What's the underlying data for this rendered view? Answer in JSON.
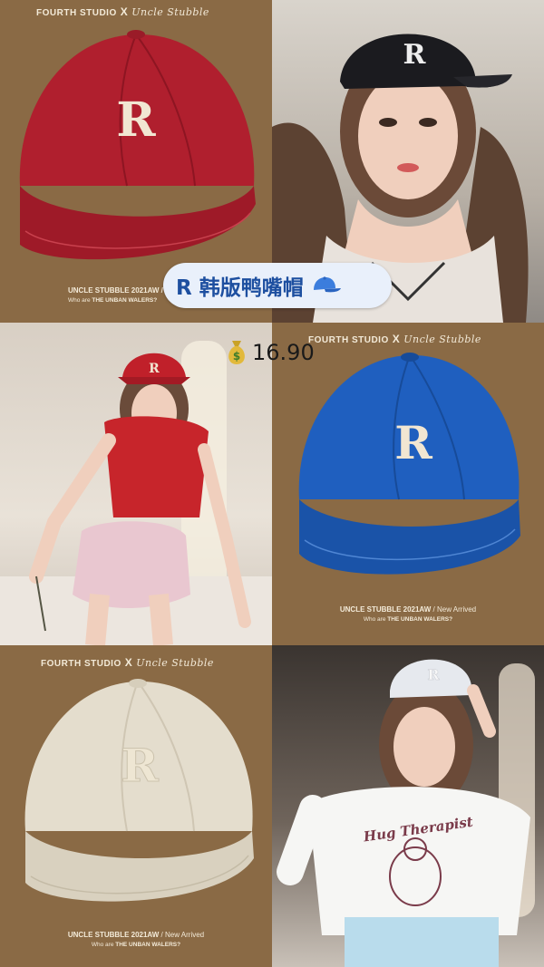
{
  "title": "R 韩版鸭嘴帽",
  "price": "16.90",
  "brand": {
    "left": "FOURTH STUDIO",
    "x": "X",
    "right": "Uncle Stubble"
  },
  "footer": {
    "line1_bold": "UNCLE STUBBLE  2021AW",
    "line1_rest": " / New Arrived",
    "line2_pre": "Who are ",
    "line2_bold": "THE UNBAN WALERS?"
  },
  "footer_partial": {
    "line1": "UNCLE STUBBLE  2021AW /",
    "line2_pre": "Who are ",
    "line2_bold": "THE UNBAN WALERS?"
  },
  "cap_letter": "R",
  "shirt_text": "Hug Therapist",
  "colors": {
    "panel_brown": "#8a6a45",
    "cap_red": "#b01f2e",
    "cap_black": "#1b1b1f",
    "cap_blue": "#1f5fbf",
    "cap_beige": "#e4ddcd",
    "tag_bg": "#e9f0fb",
    "tag_text": "#1d4fa0"
  },
  "icons": [
    "cap-icon",
    "money-bag-icon"
  ]
}
